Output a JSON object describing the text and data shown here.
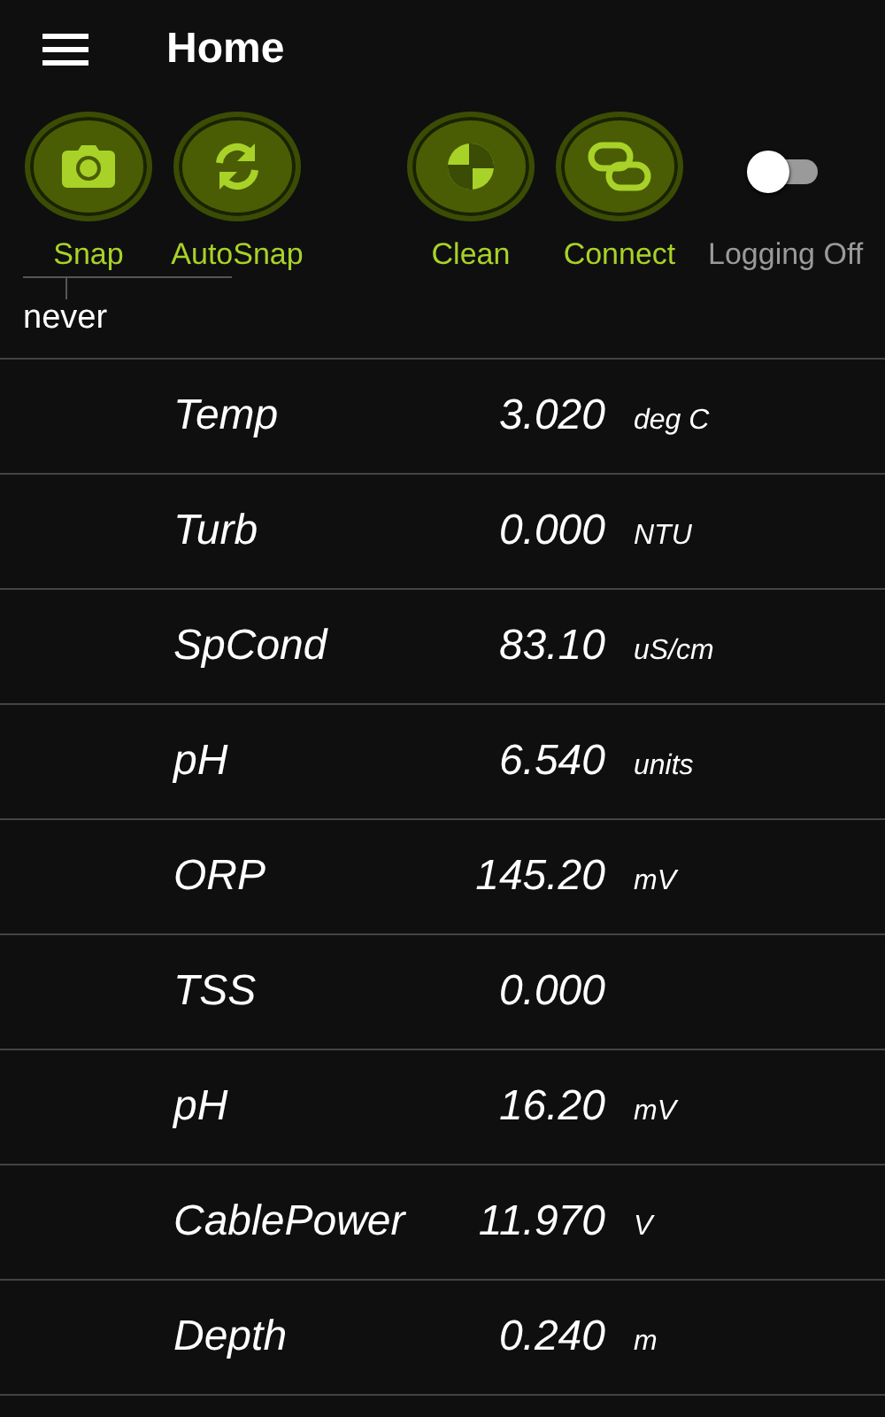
{
  "app_bar": {
    "title": "Home"
  },
  "actions": [
    {
      "kind": "camera",
      "label": "Snap"
    },
    {
      "kind": "refresh",
      "label": "AutoSnap"
    },
    {
      "kind": "quadrant",
      "label": "Clean"
    },
    {
      "kind": "link",
      "label": "Connect"
    }
  ],
  "logging": {
    "on": false,
    "label": "Logging Off"
  },
  "snap_status": "never",
  "readings": [
    {
      "name": "Temp",
      "value": "3.020",
      "unit": "deg C"
    },
    {
      "name": "Turb",
      "value": "0.000",
      "unit": "NTU"
    },
    {
      "name": "SpCond",
      "value": "83.10",
      "unit": "uS/cm"
    },
    {
      "name": "pH",
      "value": "6.540",
      "unit": "units"
    },
    {
      "name": "ORP",
      "value": "145.20",
      "unit": "mV"
    },
    {
      "name": "TSS",
      "value": "0.000"
    },
    {
      "name": "pH",
      "value": "16.20",
      "unit": "mV"
    },
    {
      "name": "CablePower",
      "value": "11.970",
      "unit": "V"
    },
    {
      "name": "Depth",
      "value": "0.240",
      "unit": "m"
    }
  ]
}
